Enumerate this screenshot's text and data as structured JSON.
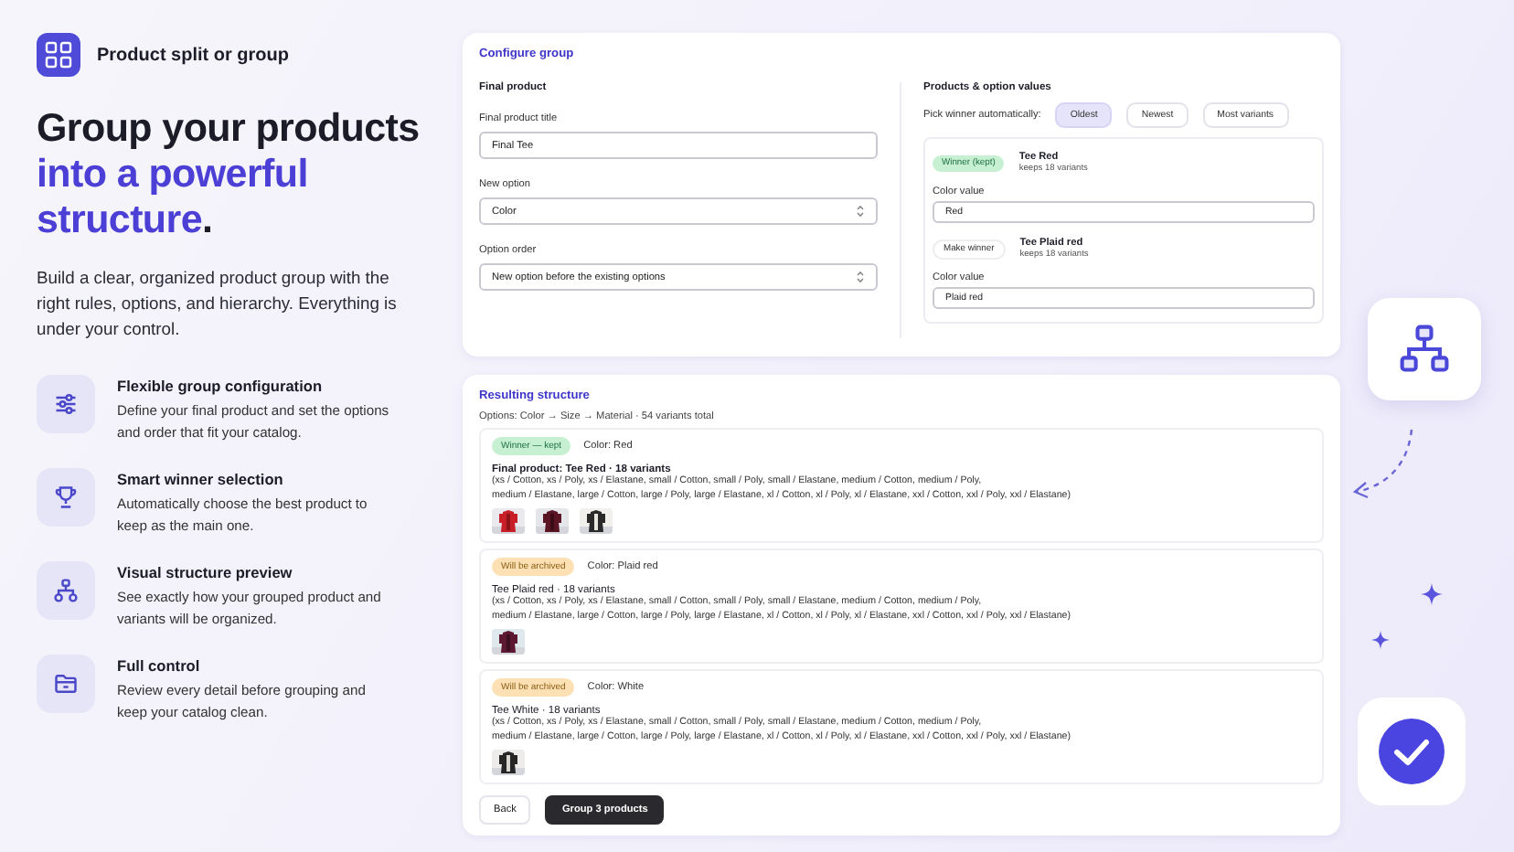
{
  "app": {
    "title": "Product split or group"
  },
  "headline": {
    "lead": "Group your products",
    "highlight": "into a powerful structure",
    "end": "."
  },
  "intro": "Build a clear, organized product group with the right rules, options, and hierarchy. Everything is under your control.",
  "features": [
    {
      "kind": "sliders",
      "title": "Flexible group configuration",
      "text": "Define your final product and set the options and order that fit your catalog."
    },
    {
      "kind": "trophy",
      "title": "Smart winner selection",
      "text": "Automatically choose the best product to keep as the main one."
    },
    {
      "kind": "tree",
      "title": "Visual structure preview",
      "text": "See exactly how your grouped product and variants will be organized."
    },
    {
      "kind": "folder",
      "title": "Full control",
      "text": "Review every detail before grouping and keep your catalog clean."
    }
  ],
  "configure": {
    "title": "Configure group",
    "final_product": {
      "heading": "Final product",
      "fields": [
        {
          "kind": "text",
          "label": "Final product title",
          "value": "Final Tee"
        },
        {
          "kind": "select",
          "label": "New option",
          "value": "Color"
        },
        {
          "kind": "select",
          "label": "Option order",
          "value": "New option before the existing options"
        }
      ]
    },
    "products": {
      "heading": "Products & option values",
      "pick_label": "Pick winner automatically:",
      "pick_options": [
        {
          "label": "Oldest",
          "selected": true
        },
        {
          "label": "Newest",
          "selected": false
        },
        {
          "label": "Most variants",
          "selected": false
        }
      ],
      "items": [
        {
          "kind": "winner",
          "action": "Winner (kept)",
          "name": "Tee Red",
          "note": "keeps 18 variants",
          "value_label": "Color value",
          "value": "Red"
        },
        {
          "kind": "candidate",
          "action": "Make winner",
          "name": "Tee Plaid red",
          "note": "keeps 18 variants",
          "value_label": "Color value",
          "value": "Plaid red"
        }
      ]
    }
  },
  "result": {
    "title": "Resulting structure",
    "summary": "Options: Color → Size → Material · 54 variants total",
    "items": [
      {
        "kind": "winner",
        "badge": "Winner — kept",
        "color_label": "Color: Red",
        "title": "Final product: Tee Red · 18 variants",
        "lines": [
          "(xs / Cotton, xs / Poly, xs / Elastane, small / Cotton, small / Poly, small / Elastane, medium / Cotton, medium / Poly,",
          "medium / Elastane, large / Cotton, large / Poly, large / Elastane, xl / Cotton, xl / Poly, xl / Elastane, xxl / Cotton, xxl / Poly, xxl / Elastane)"
        ],
        "thumbnails": [
          {
            "kind": "picture"
          },
          {
            "kind": "picture"
          },
          {
            "kind": "picture"
          }
        ]
      },
      {
        "kind": "archived",
        "badge": "Will be archived",
        "color_label": "Color: Plaid red",
        "title": "Tee Plaid red · 18 variants",
        "lines": [
          "(xs / Cotton, xs / Poly, xs / Elastane, small / Cotton, small / Poly, small / Elastane, medium / Cotton, medium / Poly,",
          "medium / Elastane, large / Cotton, large / Poly, large / Elastane, xl / Cotton, xl / Poly, xl / Elastane, xxl / Cotton, xxl / Poly, xxl / Elastane)"
        ],
        "thumbnails": [
          {
            "kind": "picture"
          }
        ]
      },
      {
        "kind": "archived",
        "badge": "Will be archived",
        "color_label": "Color: White",
        "title": "Tee White · 18 variants",
        "lines": [
          "(xs / Cotton, xs / Poly, xs / Elastane, small / Cotton, small / Poly, small / Elastane, medium / Cotton, medium / Poly,",
          "medium / Elastane, large / Cotton, large / Poly, large / Elastane, xl / Cotton, xl / Poly, xl / Elastane, xxl / Cotton, xxl / Poly, xxl / Elastane)"
        ],
        "thumbnails": [
          {
            "kind": "picture"
          }
        ]
      }
    ],
    "buttons": [
      {
        "kind": "secondary",
        "label": "Back"
      },
      {
        "kind": "primary",
        "label": "Group 3 products"
      }
    ]
  }
}
